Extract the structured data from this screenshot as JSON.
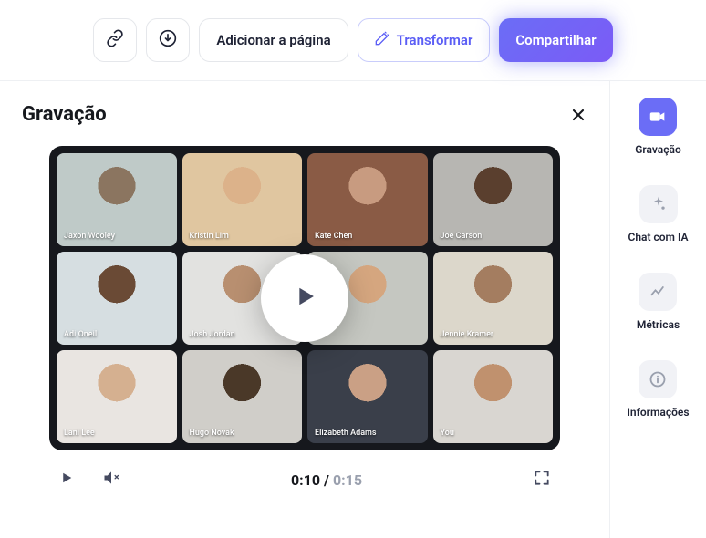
{
  "toolbar": {
    "add_page_label": "Adicionar a página",
    "transform_label": "Transformar",
    "share_label": "Compartilhar"
  },
  "panel": {
    "title": "Gravação"
  },
  "video": {
    "current_time": "0:10",
    "duration": "0:15",
    "participants": [
      {
        "name": "Jaxon Wooley"
      },
      {
        "name": "Kristin Lim"
      },
      {
        "name": "Kate Chen"
      },
      {
        "name": "Joe Carson"
      },
      {
        "name": "Adi Oneil"
      },
      {
        "name": "Josh Jordan"
      },
      {
        "name": ""
      },
      {
        "name": "Jennie Kramer"
      },
      {
        "name": "Lani Lee"
      },
      {
        "name": "Hugo Novak"
      },
      {
        "name": "Elizabeth Adams"
      },
      {
        "name": "You"
      }
    ]
  },
  "sidebar": {
    "items": [
      {
        "label": "Gravação"
      },
      {
        "label": "Chat com IA"
      },
      {
        "label": "Métricas"
      },
      {
        "label": "Informações"
      }
    ]
  }
}
